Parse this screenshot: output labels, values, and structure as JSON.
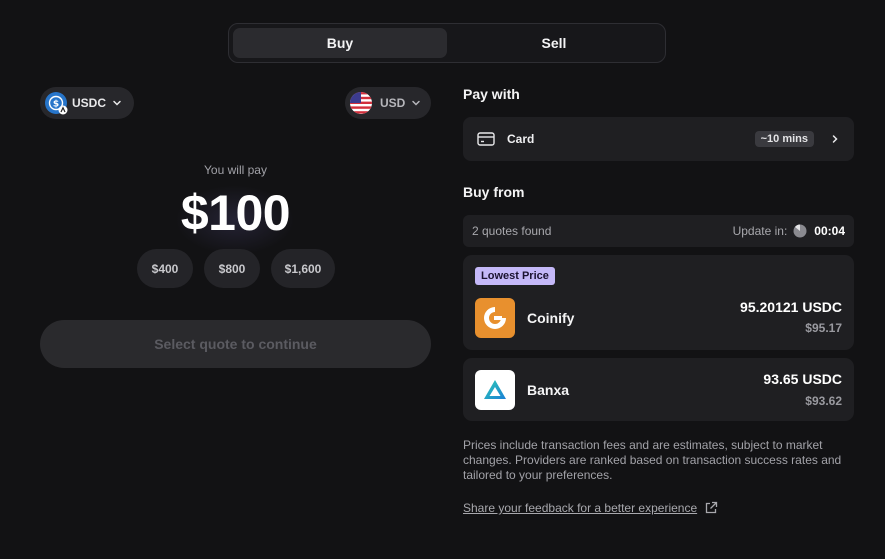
{
  "tabs": [
    {
      "label": "Buy",
      "active": true
    },
    {
      "label": "Sell",
      "active": false
    }
  ],
  "token_selector": {
    "symbol": "USDC",
    "icon": "usdc-coin-icon",
    "color": "#2775ca"
  },
  "currency_selector": {
    "code": "USD",
    "icon": "us-flag-icon"
  },
  "pay": {
    "label": "You will pay",
    "amount": "$100",
    "presets": [
      "$400",
      "$800",
      "$1,600"
    ]
  },
  "continue_button": {
    "label": "Select quote to continue",
    "enabled": false
  },
  "pay_with": {
    "title": "Pay with",
    "method": "Card",
    "method_icon": "credit-card-icon",
    "eta": "~10 mins"
  },
  "buy_from": {
    "title": "Buy from",
    "quotes_found": "2 quotes found",
    "update_label": "Update in:",
    "timer": "00:04",
    "quotes": [
      {
        "badge": "Lowest Price",
        "provider": "Coinify",
        "crypto_amount": "95.20121 USDC",
        "fiat_amount": "$95.17",
        "logo_color": "#e8902e"
      },
      {
        "badge": "",
        "provider": "Banxa",
        "crypto_amount": "93.65 USDC",
        "fiat_amount": "$93.62",
        "logo_color": "#ffffff"
      }
    ]
  },
  "disclaimer": "Prices include transaction fees and are estimates, subject to market changes. Providers are ranked based on transaction success rates and tailored to your preferences.",
  "feedback_link": "Share your feedback for a better experience",
  "colors": {
    "background": "#121214",
    "panel": "#1f1f22",
    "badge": "#c4b8f8"
  }
}
